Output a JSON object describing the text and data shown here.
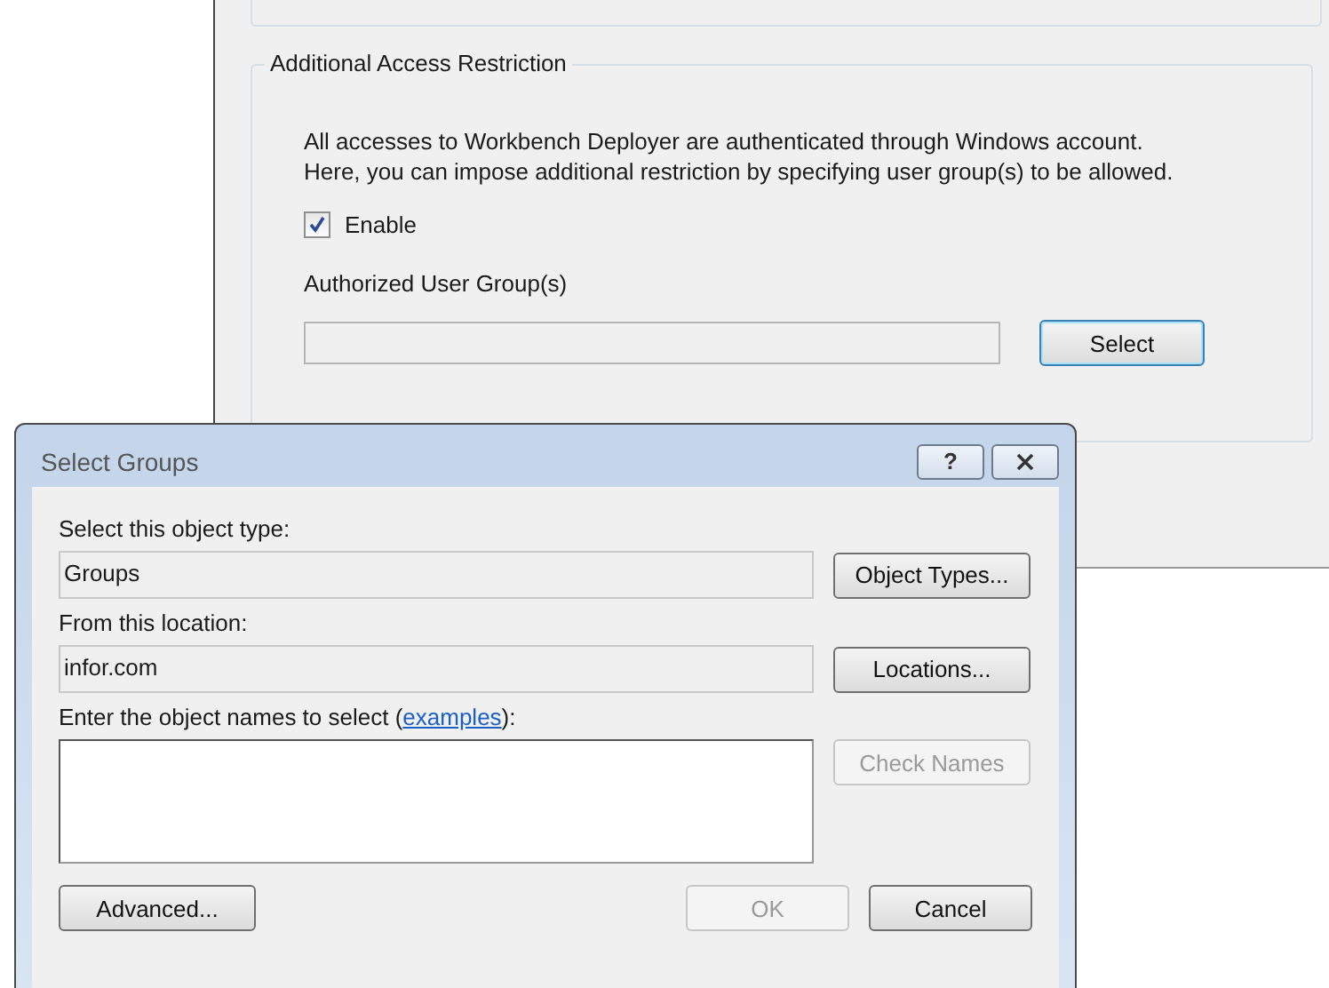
{
  "settings_window": {
    "group_box": {
      "title": "Additional Access Restriction",
      "description": "All accesses to Workbench Deployer are authenticated through Windows account.\nHere, you can impose additional restriction by specifying user group(s) to be allowed.",
      "enable_checkbox": {
        "label": "Enable",
        "checked": true
      },
      "group_field_label": "Authorized User Group(s)",
      "select_button": {
        "label": "Select",
        "focused": true
      }
    }
  },
  "dialog": {
    "title": "Select Groups",
    "title_buttons": [
      {
        "kind": "help",
        "label": "?"
      },
      {
        "kind": "close"
      }
    ],
    "object_type": {
      "label": "Select this object type:",
      "value": "Groups",
      "button": {
        "label": "Object Types...",
        "disabled": false
      }
    },
    "location": {
      "label": "From this location:",
      "value": "infor.com",
      "button": {
        "label": "Locations...",
        "disabled": false
      }
    },
    "names": {
      "label": "Enter the object names to select (",
      "link": "examples",
      "label_end": "):",
      "button": {
        "label": "Check Names",
        "disabled": true
      }
    },
    "footer_left_buttons": [
      {
        "label": "Advanced...",
        "disabled": false
      }
    ],
    "footer_right_buttons": [
      {
        "label": "OK",
        "disabled": true
      },
      {
        "label": "Cancel",
        "disabled": false
      }
    ]
  }
}
